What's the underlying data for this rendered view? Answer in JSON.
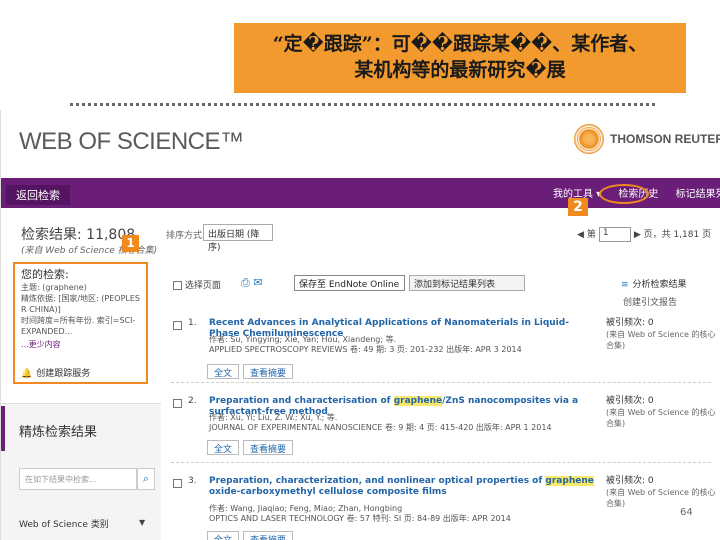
{
  "banner": {
    "line1": "“定�跟踪”：可��跟踪某��、某作者、",
    "line2": "某机构等的最新研究�展"
  },
  "header": {
    "logo": "WEB OF SCIENCE™",
    "publisher": "THOMSON REUTERS™"
  },
  "nav": {
    "back": "返回检索",
    "my_tools": "我的工具 ▾",
    "history": "检索历史",
    "marked_list": "标记结果列表"
  },
  "markers": {
    "one": "1",
    "two": "2"
  },
  "results": {
    "title": "检索结果: 11,808",
    "subtitle": "(来自 Web of Science 核心合集)",
    "search_label": "您的检索:",
    "search_lines": [
      "主题: (graphene)",
      "精炼依据: [国家/地区: (PEOPLES R CHINA)]",
      "时间跨度=所有年份. 索引=SCI-EXPANDED..."
    ],
    "less": "...更少内容",
    "alert": "创建跟踪服务"
  },
  "refine": {
    "title": "精炼检索结果",
    "placeholder": "在如下结果中检索...",
    "category": "Web of Science 类别"
  },
  "sort": {
    "label": "排序方式:",
    "value": "出版日期 (降序)"
  },
  "pager": {
    "page": "1",
    "total": "页，共 1,181 页"
  },
  "toolbar": {
    "select_page": "选择页面",
    "save_to": "保存至 EndNote Online",
    "add_marked": "添加到标记结果列表",
    "analyze": "分析检索结果",
    "cite_report": "创建引文报告"
  },
  "records": [
    {
      "num": "1.",
      "title_before": "Recent Advances in Analytical Applications of Nanomaterials in Liquid-Phase Chemiluminescence",
      "title_hl": "",
      "title_after": "",
      "authors": "作者: Su, Yingying; Xie, Yan; Hou, Xiandeng; 等.",
      "source": "APPLIED SPECTROSCOPY REVIEWS 卷: 49 期: 3 页: 201-232 出版年: APR 3 2014",
      "cited": "被引频次: 0",
      "cited_from": "(来自 Web of Science 的核心合集)",
      "btn_full": "全文",
      "btn_abstract": "查看摘要"
    },
    {
      "num": "2.",
      "title_before": "Preparation and characterisation of ",
      "title_hl": "graphene",
      "title_after": "/ZnS nanocomposites via a surfactant-free method",
      "authors": "作者: Xu, Yi; Liu, Z. W.; Xu, Y.; 等.",
      "source": "JOURNAL OF EXPERIMENTAL NANOSCIENCE 卷: 9 期: 4 页: 415-420 出版年: APR 1 2014",
      "cited": "被引频次: 0",
      "cited_from": "(来自 Web of Science 的核心合集)",
      "btn_full": "全文",
      "btn_abstract": "查看摘要"
    },
    {
      "num": "3.",
      "title_before": "Preparation, characterization, and nonlinear optical properties of ",
      "title_hl": "graphene",
      "title_after": " oxide-carboxymethyl cellulose composite films",
      "authors": "作者: Wang, Jiaqiao; Feng, Miao; Zhan, Hongbing",
      "source": "OPTICS AND LASER TECHNOLOGY 卷: 57 特刊: SI 页: 84-89 出版年: APR 2014",
      "cited": "被引频次: 0",
      "cited_from": "(来自 Web of Science 的核心合集)",
      "btn_full": "全文",
      "btn_abstract": "查看摘要"
    }
  ],
  "slide_page": "64",
  "colors": {
    "banner": "#f39a2e",
    "nav": "#6a1e78",
    "link": "#2265a8",
    "highlight": "#f7e86a"
  }
}
